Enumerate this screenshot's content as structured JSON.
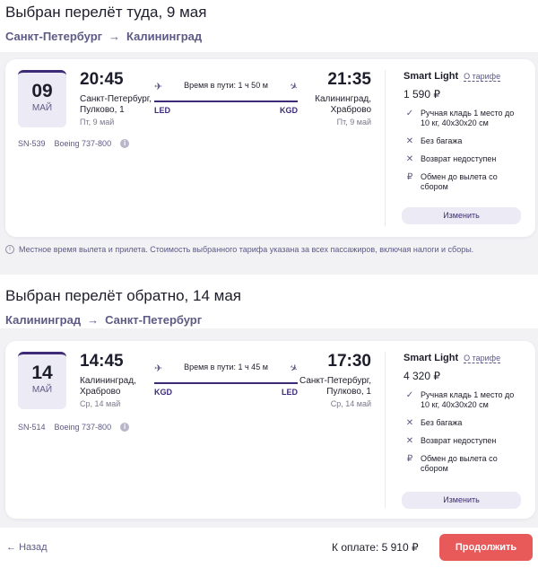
{
  "outbound": {
    "title": "Выбран перелёт туда, 9 мая",
    "from": "Санкт-Петербург",
    "to": "Калининград",
    "day": "09",
    "month": "МАЙ",
    "dep_time": "20:45",
    "dep_city_1": "Санкт-Петербург,",
    "dep_city_2": "Пулково, 1",
    "dep_dow": "Пт, 9 май",
    "duration": "Время в пути: 1 ч 50 м",
    "dep_code": "LED",
    "arr_code": "KGD",
    "arr_time": "21:35",
    "arr_city_1": "Калининград,",
    "arr_city_2": "Храброво",
    "arr_dow": "Пт, 9 май",
    "flight_no": "SN-539",
    "aircraft": "Boeing 737-800",
    "fare_name": "Smart Light",
    "fare_link": "О тарифе",
    "price": "1 590 ₽",
    "features": [
      {
        "icon": "check-icon",
        "text_1": "Ручная кладь 1 место до",
        "text_2": "10 кг, 40х30х20 см"
      },
      {
        "icon": "cross-icon",
        "text_1": "Без багажа",
        "text_2": ""
      },
      {
        "icon": "cross-icon",
        "text_1": "Возврат недоступен",
        "text_2": ""
      },
      {
        "icon": "ruble-icon",
        "text_1": "Обмен до вылета со",
        "text_2": "сбором"
      }
    ],
    "change_label": "Изменить"
  },
  "note": "Местное время вылета и прилета. Стоимость выбранного тарифа указана за всех пассажиров, включая налоги и сборы.",
  "inbound": {
    "title": "Выбран перелёт обратно, 14 мая",
    "from": "Калининград",
    "to": "Санкт-Петербург",
    "day": "14",
    "month": "МАЙ",
    "dep_time": "14:45",
    "dep_city_1": "Калининград,",
    "dep_city_2": "Храброво",
    "dep_dow": "Ср, 14 май",
    "duration": "Время в пути: 1 ч 45 м",
    "dep_code": "KGD",
    "arr_code": "LED",
    "arr_time": "17:30",
    "arr_city_1": "Санкт-Петербург,",
    "arr_city_2": "Пулково, 1",
    "arr_dow": "Ср, 14 май",
    "flight_no": "SN-514",
    "aircraft": "Boeing 737-800",
    "fare_name": "Smart Light",
    "fare_link": "О тарифе",
    "price": "4 320 ₽",
    "features": [
      {
        "icon": "check-icon",
        "text_1": "Ручная кладь 1 место до",
        "text_2": "10 кг, 40х30х20 см"
      },
      {
        "icon": "cross-icon",
        "text_1": "Без багажа",
        "text_2": ""
      },
      {
        "icon": "cross-icon",
        "text_1": "Возврат недоступен",
        "text_2": ""
      },
      {
        "icon": "ruble-icon",
        "text_1": "Обмен до вылета со",
        "text_2": "сбором"
      }
    ],
    "change_label": "Изменить"
  },
  "footer": {
    "back_label": "Назад",
    "total": "К оплате: 5 910 ₽",
    "continue_label": "Продолжить"
  },
  "colors": {
    "accent": "#3d2b78",
    "muted": "#5d5a85",
    "cta": "#e8595a",
    "background": "#f2f2f5"
  }
}
